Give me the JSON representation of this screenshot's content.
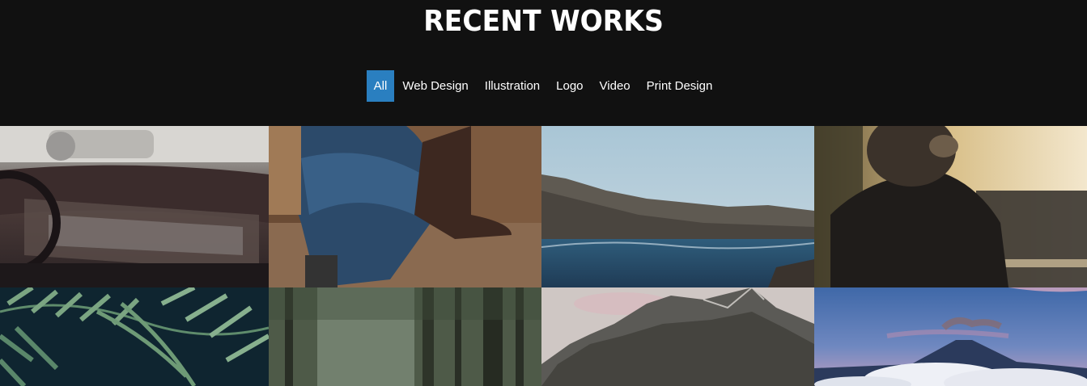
{
  "section": {
    "title": "RECENT WORKS"
  },
  "filters": [
    {
      "label": "All",
      "active": true
    },
    {
      "label": "Web Design",
      "active": false
    },
    {
      "label": "Illustration",
      "active": false
    },
    {
      "label": "Logo",
      "active": false
    },
    {
      "label": "Video",
      "active": false
    },
    {
      "label": "Print Design",
      "active": false
    }
  ],
  "colors": {
    "background": "#111111",
    "accent": "#2a7fc0",
    "text": "#ffffff"
  }
}
